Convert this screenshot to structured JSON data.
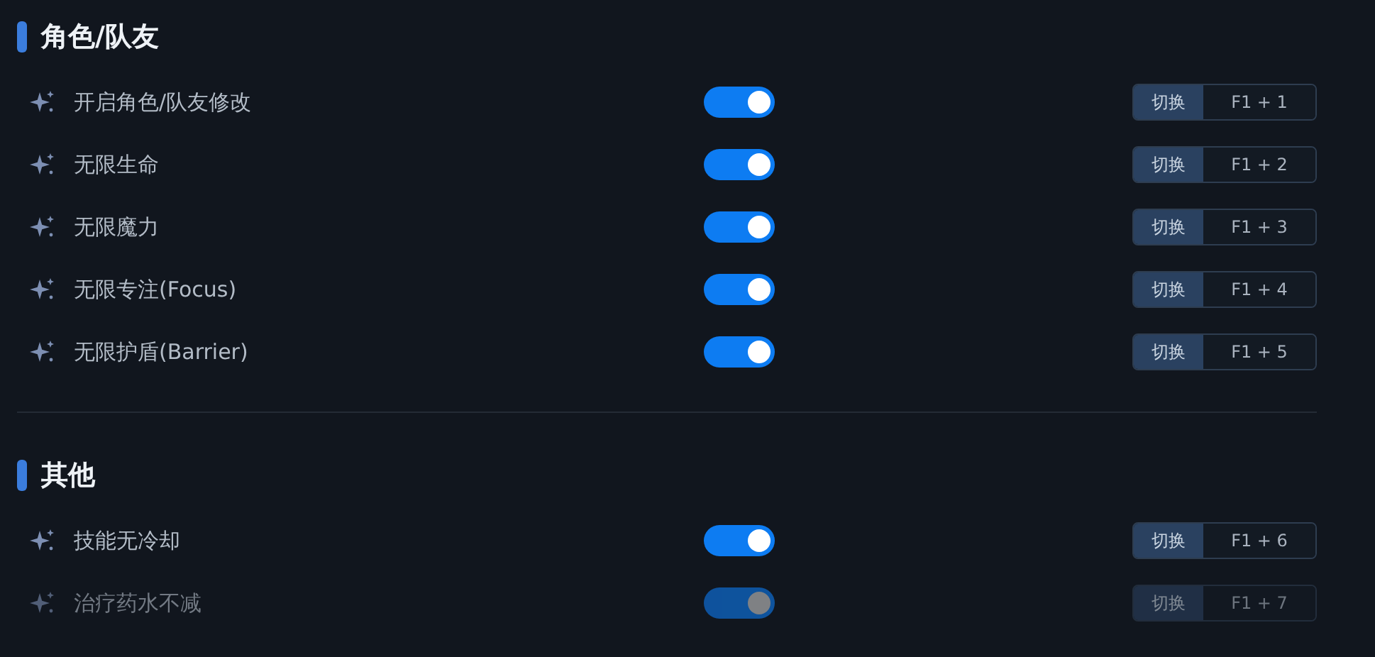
{
  "sections": [
    {
      "title": "角色/队友",
      "items": [
        {
          "label": "开启角色/队友修改",
          "on": true,
          "dimmed": false,
          "action": "切换",
          "hotkey": "F1 + 1"
        },
        {
          "label": "无限生命",
          "on": true,
          "dimmed": false,
          "action": "切换",
          "hotkey": "F1 + 2"
        },
        {
          "label": "无限魔力",
          "on": true,
          "dimmed": false,
          "action": "切换",
          "hotkey": "F1 + 3"
        },
        {
          "label": "无限专注(Focus)",
          "on": true,
          "dimmed": false,
          "action": "切换",
          "hotkey": "F1 + 4"
        },
        {
          "label": "无限护盾(Barrier)",
          "on": true,
          "dimmed": false,
          "action": "切换",
          "hotkey": "F1 + 5"
        }
      ]
    },
    {
      "title": "其他",
      "items": [
        {
          "label": "技能无冷却",
          "on": true,
          "dimmed": false,
          "action": "切换",
          "hotkey": "F1 + 6"
        },
        {
          "label": "治疗药水不减",
          "on": true,
          "dimmed": true,
          "action": "切换",
          "hotkey": "F1 + 7"
        }
      ]
    }
  ]
}
